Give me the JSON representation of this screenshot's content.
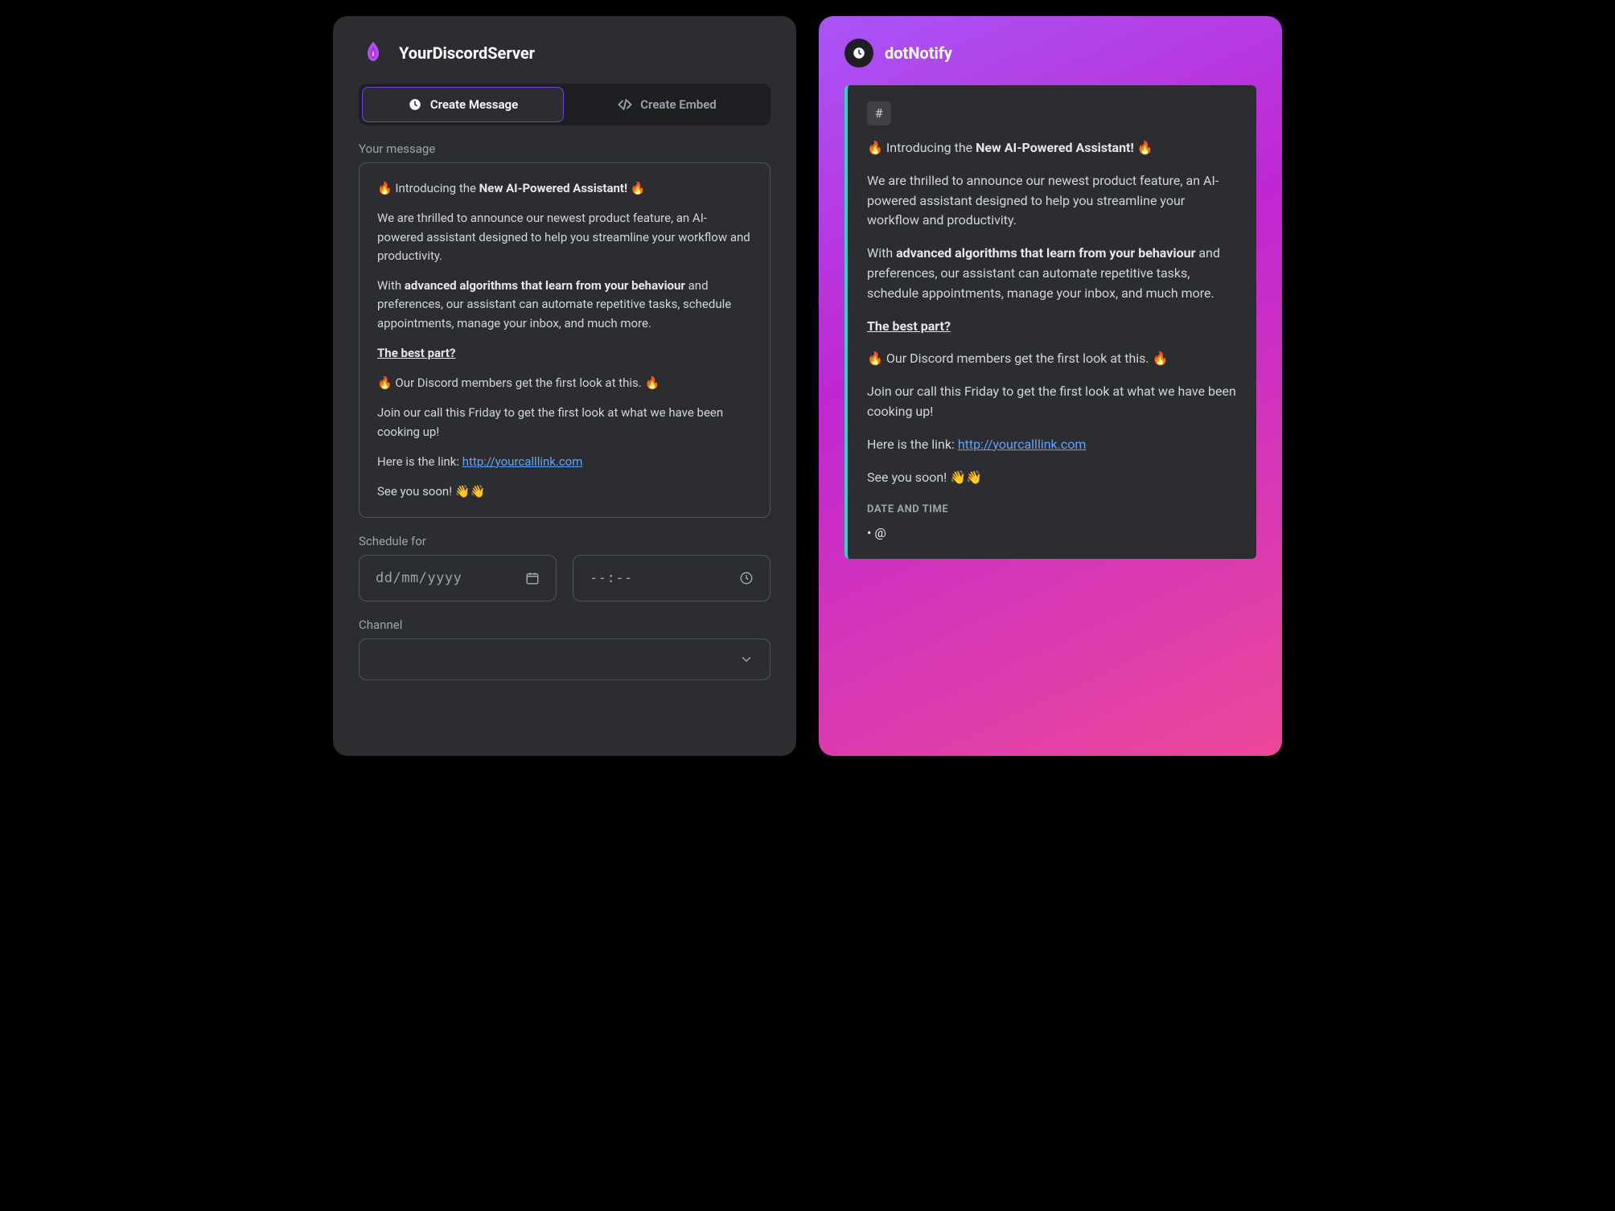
{
  "server": {
    "name": "YourDiscordServer"
  },
  "tabs": {
    "create_message": "Create Message",
    "create_embed": "Create Embed"
  },
  "form": {
    "message_label": "Your message",
    "schedule_label": "Schedule for",
    "channel_label": "Channel",
    "date_placeholder": "dd/mm/yyyy",
    "time_placeholder": "--:--"
  },
  "message": {
    "intro_pre": "🔥 Introducing the ",
    "intro_bold": "New AI-Powered Assistant!",
    "intro_post": " 🔥",
    "p2": "We are thrilled to announce our newest product feature, an AI-powered assistant designed to help you streamline your workflow and productivity.",
    "p3_pre": "With ",
    "p3_bold": "advanced algorithms that learn from your behaviour",
    "p3_post": " and preferences, our assistant can automate repetitive tasks, schedule appointments, manage your inbox, and much more.",
    "best_part": "The best part?",
    "p5": "🔥 Our Discord members get the first look at this. 🔥",
    "p6": "Join our call this Friday to get the first look at what we have been cooking up!",
    "link_pre": " Here is the link: ",
    "link_text": "http://yourcalllink.com",
    "see_you": " See you soon! 👋👋"
  },
  "preview": {
    "bot_name": "dotNotify",
    "hash": "#",
    "date_time_label": "DATE AND TIME",
    "dot_at": " • @"
  }
}
